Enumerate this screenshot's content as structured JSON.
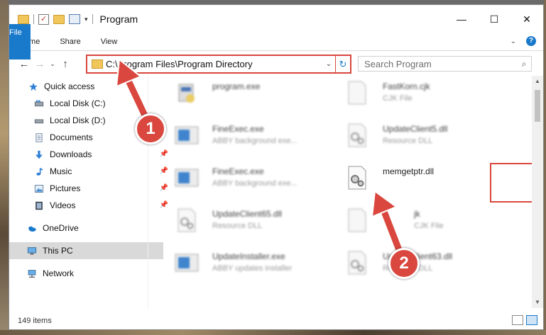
{
  "window": {
    "title": "Program",
    "controls": {
      "minimize": "—",
      "maximize": "☐",
      "close": "✕"
    }
  },
  "ribbon": {
    "tabs": [
      "File",
      "Home",
      "Share",
      "View"
    ],
    "help_label": "?"
  },
  "address_bar": {
    "path": "C:\\Program Files\\Program Directory",
    "search_placeholder": "Search Program"
  },
  "nav_pane": {
    "items": [
      {
        "label": "Quick access",
        "icon": "star-icon"
      },
      {
        "label": "Local Disk (C:)",
        "icon": "drive-icon"
      },
      {
        "label": "Local Disk (D:)",
        "icon": "drive-icon"
      },
      {
        "label": "Documents",
        "icon": "documents-icon"
      },
      {
        "label": "Downloads",
        "icon": "download-icon",
        "pinned": true
      },
      {
        "label": "Music",
        "icon": "music-icon",
        "pinned": true
      },
      {
        "label": "Pictures",
        "icon": "pictures-icon",
        "pinned": true
      },
      {
        "label": "Videos",
        "icon": "videos-icon",
        "pinned": true
      },
      {
        "label": "OneDrive",
        "icon": "cloud-icon"
      },
      {
        "label": "This PC",
        "icon": "pc-icon",
        "selected": true
      },
      {
        "label": "Network",
        "icon": "network-icon"
      }
    ]
  },
  "files": [
    {
      "name": "program.exe",
      "type": ""
    },
    {
      "name": "FastKorn.cjk",
      "type": "CJK File"
    },
    {
      "name": "FineExec.exe",
      "type": "ABBY background exe..."
    },
    {
      "name": "UpdateClient5.dll",
      "type": "Resource DLL"
    },
    {
      "name": "FineExec.exe",
      "type": "ABBY background exe..."
    },
    {
      "name": "memgetptr.dll",
      "type": ""
    },
    {
      "name": "UpdateClient65.dll",
      "type": "Resource DLL"
    },
    {
      "name": "jk",
      "type": "CJK File"
    },
    {
      "name": "UpdateInstaller.exe",
      "type": "ABBY updates installer"
    },
    {
      "name": "UpdateClient63.dll",
      "type": "Resource DLL"
    }
  ],
  "status": {
    "item_count": "149 items"
  },
  "callouts": [
    "1",
    "2"
  ],
  "colors": {
    "accent": "#1979ca",
    "highlight": "#d9473e"
  }
}
